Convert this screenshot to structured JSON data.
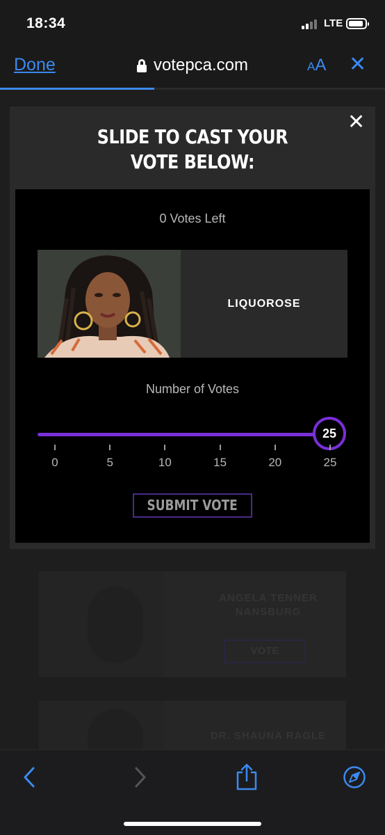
{
  "status_bar": {
    "time": "18:34",
    "network": "LTE"
  },
  "browser": {
    "done_label": "Done",
    "url": "votepca.com",
    "text_size_small": "A",
    "text_size_large": "A",
    "close_glyph": "✕",
    "load_progress": 0.4,
    "accent_color": "#3b8af0"
  },
  "modal": {
    "title_line1": "SLIDE TO CAST YOUR",
    "title_line2": "VOTE BELOW:",
    "close_glyph": "✕",
    "votes_left": "0 Votes Left",
    "candidate_name": "LIQUOROSE",
    "number_of_votes_label": "Number of Votes",
    "slider": {
      "value": 25,
      "min": 0,
      "max": 25,
      "ticks": [
        "0",
        "5",
        "10",
        "15",
        "20",
        "25"
      ],
      "color": "#7a2fd8"
    },
    "submit_label": "SUBMIT VOTE"
  },
  "background_cards": [
    {
      "name_line1": "ANGELA TENNER",
      "name_line2": "NANSBURG",
      "button": "VOTE"
    },
    {
      "name_line1": "DR. SHAUNA RAGLE",
      "name_line2": "",
      "button": ""
    }
  ],
  "toolbar": {
    "icons": [
      "back-icon",
      "forward-icon",
      "share-icon",
      "safari-compass-icon"
    ]
  }
}
